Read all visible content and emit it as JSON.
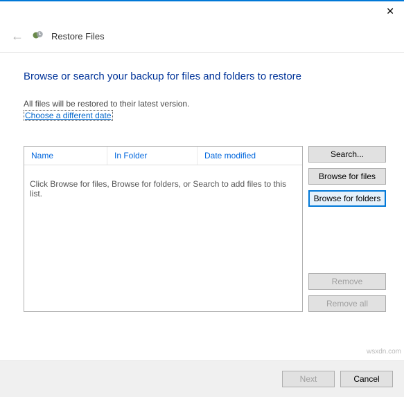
{
  "window": {
    "title": "Restore Files"
  },
  "content": {
    "heading": "Browse or search your backup for files and folders to restore",
    "info_line": "All files will be restored to their latest version.",
    "link_line": "Choose a different date"
  },
  "list": {
    "columns": {
      "name": "Name",
      "folder": "In Folder",
      "date": "Date modified"
    },
    "empty_text": "Click Browse for files, Browse for folders, or Search to add files to this list."
  },
  "buttons": {
    "search": "Search...",
    "browse_files": "Browse for files",
    "browse_folders": "Browse for folders",
    "remove": "Remove",
    "remove_all": "Remove all",
    "next": "Next",
    "cancel": "Cancel"
  },
  "watermark": "wsxdn.com"
}
